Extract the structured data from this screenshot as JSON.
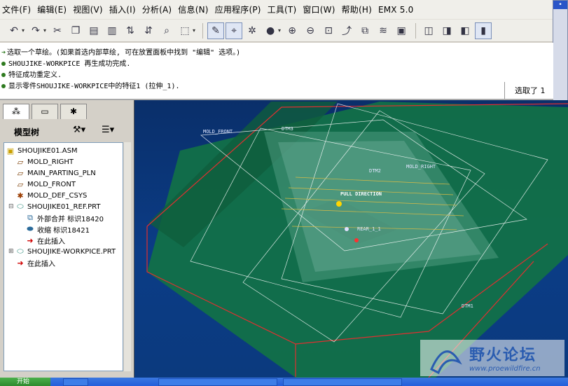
{
  "menu": [
    "文件(F)",
    "编辑(E)",
    "视图(V)",
    "插入(I)",
    "分析(A)",
    "信息(N)",
    "应用程序(P)",
    "工具(T)",
    "窗口(W)",
    "帮助(H)",
    "EMX 5.0"
  ],
  "messages": [
    "选取一个草绘。(如果首选内部草绘, 可在放置面板中找到 \"编辑\" 选项。)",
    "SHOUJIKE-WORKPICE 再生成功完成.",
    "特征成功重定义.",
    "显示零件SHOUJIKE-WORKPICE中的特征1 (拉伸_1)."
  ],
  "selected_label": "选取了 1",
  "navigator": {
    "header": "模型树",
    "items": [
      {
        "label": "SHOUJIKE01.ASM",
        "icon": "assembly-icon",
        "indent": 0
      },
      {
        "label": "MOLD_RIGHT",
        "icon": "datum-plane-icon",
        "indent": 1
      },
      {
        "label": "MAIN_PARTING_PLN",
        "icon": "datum-plane-icon",
        "indent": 1
      },
      {
        "label": "MOLD_FRONT",
        "icon": "datum-plane-icon",
        "indent": 1
      },
      {
        "label": "MOLD_DEF_CSYS",
        "icon": "csys-icon",
        "indent": 1
      },
      {
        "label": "SHOUJIKE01_REF.PRT",
        "icon": "part-icon",
        "indent": 1
      },
      {
        "label": "外部合并 标识18420",
        "icon": "merge-icon",
        "indent": 2
      },
      {
        "label": "收缩 标识18421",
        "icon": "shrink-icon",
        "indent": 2
      },
      {
        "label": "在此插入",
        "icon": "insert-here-icon",
        "indent": 2
      },
      {
        "label": "SHOUJIKE-WORKPICE.PRT",
        "icon": "part-icon",
        "indent": 1
      },
      {
        "label": "在此插入",
        "icon": "insert-here-icon",
        "indent": 1
      }
    ]
  },
  "graphics": {
    "labels": [
      "MOLD_FRONT",
      "DTM3",
      "DTM2",
      "MOLD_RIGHT",
      "PULL DIRECTION",
      "REAR_1_1",
      "DTM1"
    ]
  },
  "taskbar": {
    "start": "开始"
  },
  "watermark": {
    "title": "野火论坛",
    "url": "www.proewildfire.cn"
  }
}
